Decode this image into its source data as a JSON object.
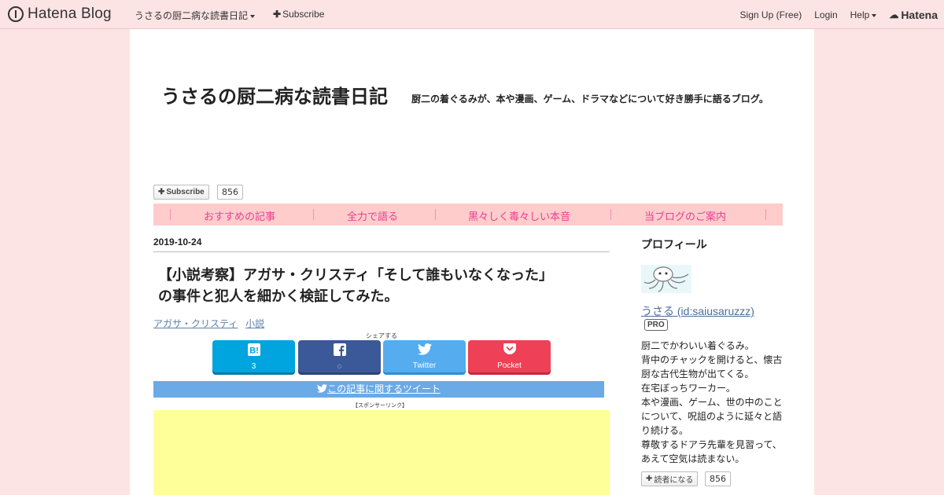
{
  "globalbar": {
    "logo_text": "Hatena Blog",
    "blog_name": "うさるの厨二病な読書日記",
    "subscribe": "Subscribe",
    "signup": "Sign Up (Free)",
    "login": "Login",
    "help": "Help",
    "hatena": "Hatena"
  },
  "header": {
    "title": "うさるの厨二病な読書日記",
    "description": "厨二の着ぐるみが、本や漫画、ゲーム、ドラマなどについて好き勝手に語るブログ。",
    "subscribe_label": "Subscribe",
    "subscriber_count": "856"
  },
  "nav": {
    "items": [
      {
        "label": "おすすめの記事"
      },
      {
        "label": "全力で語る"
      },
      {
        "label": "黒々しく毒々しい本音"
      },
      {
        "label": "当ブログのご案内"
      }
    ]
  },
  "entry": {
    "date": "2019-10-24",
    "title_line1": "【小説考察】アガサ・クリスティ「そして誰もいなくなった」",
    "title_line2": "の事件と犯人を細かく検証してみた。",
    "categories": [
      "アガサ・クリスティ",
      "小説"
    ],
    "share_label": "シェアする",
    "share": {
      "hatebu_count": "3",
      "twitter_label": "Twitter",
      "pocket_label": "Pocket"
    },
    "tweet_link": "この記事に関するツイート",
    "sponsor_label": "【スポンサーリンク】"
  },
  "sidebar": {
    "profile_title": "プロフィール",
    "user_name": "うさる (id:saiusaruzzz)",
    "pro_badge": "PRO",
    "bio_lines": [
      "厨二でかわいい着ぐるみ。",
      "背中のチャックを開けると、懐古",
      "厨な古代生物が出てくる。",
      "在宅ぼっちワーカー。",
      "本や漫画、ゲーム、世の中のこと",
      "について、呪詛のように延々と語",
      "り続ける。",
      "尊敬するドアラ先輩を見習って、",
      "あえて空気は読まない。"
    ],
    "reader_button": "読者になる",
    "reader_count": "856"
  },
  "colors": {
    "page_bg": "#fde4e4",
    "nav_bg": "#ffcccc",
    "nav_text": "#e93f91",
    "link": "#5c7fa8",
    "ad_bg": "#ffff99"
  }
}
